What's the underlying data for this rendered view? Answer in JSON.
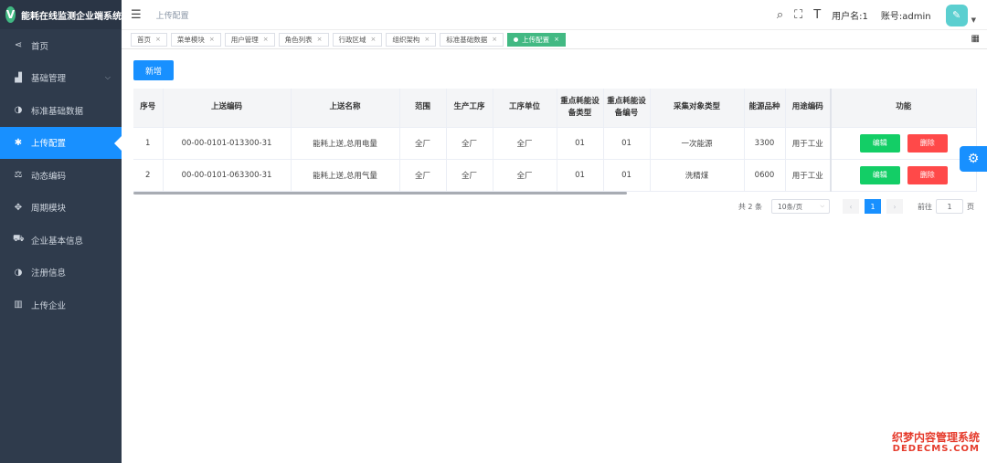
{
  "app": {
    "title": "能耗在线监测企业端系统",
    "logo_letter": "V"
  },
  "sidebar": {
    "items": [
      {
        "label": "首页",
        "icon": "share-icon",
        "glyph": "⋖"
      },
      {
        "label": "基础管理",
        "icon": "chart-icon",
        "glyph": "▟"
      },
      {
        "label": "标准基础数据",
        "icon": "contrast-icon",
        "glyph": "◑"
      },
      {
        "label": "上传配置",
        "icon": "asterisk-icon",
        "glyph": "✱"
      },
      {
        "label": "动态编码",
        "icon": "scale-icon",
        "glyph": "⚖"
      },
      {
        "label": "周期模块",
        "icon": "move-icon",
        "glyph": "✥"
      },
      {
        "label": "企业基本信息",
        "icon": "car-icon",
        "glyph": "⛟"
      },
      {
        "label": "注册信息",
        "icon": "contrast-icon",
        "glyph": "◑"
      },
      {
        "label": "上传企业",
        "icon": "barcode-icon",
        "glyph": "▥"
      }
    ]
  },
  "header": {
    "breadcrumb": "上传配置",
    "user_name": "用户名:1",
    "account": "账号:admin",
    "avatar_glyph": "✎"
  },
  "tags": [
    {
      "label": "首页"
    },
    {
      "label": "菜单模块"
    },
    {
      "label": "用户管理"
    },
    {
      "label": "角色列表"
    },
    {
      "label": "行政区域"
    },
    {
      "label": "组织架构"
    },
    {
      "label": "标准基础数据"
    },
    {
      "label": "上传配置"
    }
  ],
  "toolbar": {
    "add_label": "新增"
  },
  "table": {
    "headers": [
      "序号",
      "上送编码",
      "上送名称",
      "范围",
      "生产工序",
      "工序单位",
      "重点耗能设备类型",
      "重点耗能设备编号",
      "采集对象类型",
      "能源品种",
      "用途编码",
      "功能"
    ],
    "rows": [
      [
        "1",
        "00-00-0101-013300-31",
        "能耗上送,总用电量",
        "全厂",
        "全厂",
        "全厂",
        "01",
        "01",
        "一次能源",
        "3300",
        "用于工业"
      ],
      [
        "2",
        "00-00-0101-063300-31",
        "能耗上送,总用气量",
        "全厂",
        "全厂",
        "全厂",
        "01",
        "01",
        "洗精煤",
        "0600",
        "用于工业"
      ]
    ],
    "edit_label": "编辑",
    "delete_label": "删除"
  },
  "pagination": {
    "total": "共 2 条",
    "page_size": "10条/页",
    "current_page": "1",
    "goto_label": "前往",
    "goto_value": "1",
    "page_suffix": "页"
  },
  "watermark": {
    "line1": "织梦内容管理系统",
    "line2": "DEDECMS.COM"
  },
  "colors": {
    "primary": "#1890ff",
    "tag_active": "#42b983",
    "edit": "#13ce66",
    "delete": "#ff4949",
    "sidebar": "#2f3b4c"
  }
}
